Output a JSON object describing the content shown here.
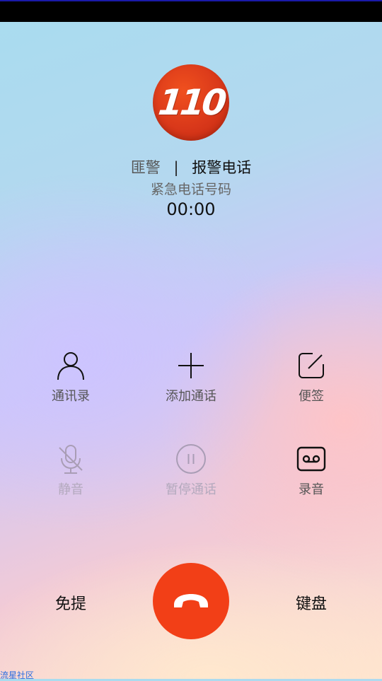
{
  "call": {
    "avatar_text": "110",
    "caller_tag": "匪警",
    "separator": "|",
    "caller_name": "报警电话",
    "description": "紧急电话号码",
    "timer": "00:00"
  },
  "actions": {
    "contacts": "通讯录",
    "add_call": "添加通话",
    "notes": "便签",
    "mute": "静音",
    "hold": "暂停通话",
    "record": "录音"
  },
  "bottom": {
    "speaker": "免提",
    "keypad": "键盘"
  },
  "watermark": "流星社区",
  "colors": {
    "end_call": "#f23f17",
    "avatar": "#d9381a"
  }
}
